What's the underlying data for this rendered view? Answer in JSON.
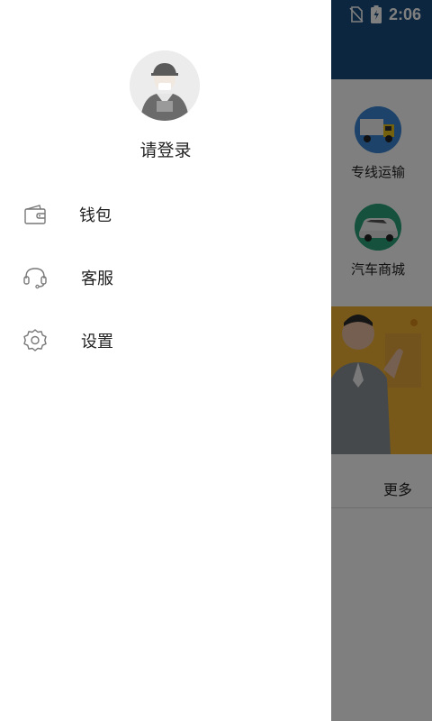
{
  "status_bar": {
    "time": "2:06"
  },
  "drawer": {
    "login_prompt": "请登录",
    "menu": [
      {
        "label": "钱包",
        "icon": "wallet-icon"
      },
      {
        "label": "客服",
        "icon": "headset-icon"
      },
      {
        "label": "设置",
        "icon": "gear-icon"
      }
    ]
  },
  "background": {
    "services": [
      {
        "label": "专线运输",
        "icon": "truck-icon",
        "color": "#3a86d6"
      },
      {
        "label": "汽车商城",
        "icon": "car-icon",
        "color": "#2aa37a"
      }
    ],
    "more_label": "更多"
  },
  "colors": {
    "header": "#1b4d7e",
    "banner": "#f2b233",
    "scrim": "rgba(0,0,0,0.5)"
  }
}
